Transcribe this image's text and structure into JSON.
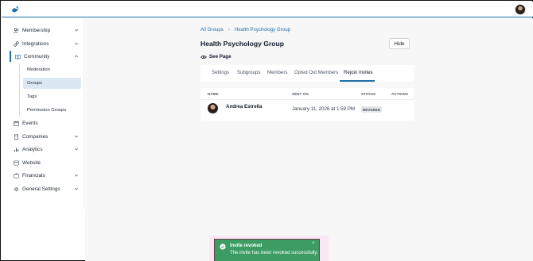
{
  "topbar": {
    "logo_icon": "brand-logo-icon",
    "avatar_icon": "user-avatar"
  },
  "sidebar": {
    "items": [
      {
        "label": "Membership",
        "icon": "people-icon",
        "chevron": "chevron-down-icon"
      },
      {
        "label": "Integrations",
        "icon": "link-icon",
        "chevron": "chevron-down-icon"
      },
      {
        "label": "Community",
        "icon": "book-icon",
        "chevron": "chevron-up-icon",
        "expanded": true,
        "children": [
          "Moderation",
          "Groups",
          "Tags",
          "Permission Groups"
        ],
        "active_child": "Groups"
      },
      {
        "label": "Events",
        "icon": "calendar-icon"
      },
      {
        "label": "Companies",
        "icon": "building-icon",
        "chevron": "chevron-down-icon"
      },
      {
        "label": "Analytics",
        "icon": "bar-chart-icon",
        "chevron": "chevron-down-icon"
      },
      {
        "label": "Website",
        "icon": "globe-icon"
      },
      {
        "label": "Financials",
        "icon": "wallet-icon",
        "chevron": "chevron-down-icon"
      },
      {
        "label": "General Settings",
        "icon": "gear-icon",
        "chevron": "chevron-down-icon"
      }
    ]
  },
  "breadcrumb": {
    "parent": "All Groups",
    "separator": "›",
    "current": "Health Psychology Group"
  },
  "page": {
    "title": "Health Psychology Group",
    "hide_label": "Hide",
    "see_page_label": "See Page"
  },
  "tabs": [
    "Settings",
    "Subgroups",
    "Members",
    "Opted Out Members",
    "Rejoin Invites"
  ],
  "active_tab": "Rejoin Invites",
  "table": {
    "headers": [
      "NAME",
      "SENT ON",
      "STATUS",
      "ACTIONS"
    ],
    "rows": [
      {
        "name": "Andrea Estrella",
        "sent_on": "January 11, 2026 at 1:59 PM",
        "status": "REVOKED"
      }
    ]
  },
  "toast": {
    "title": "Invite revoked",
    "message": "The invite has been revoked successfully.",
    "close": "×"
  },
  "colors": {
    "accent": "#1e6fa8",
    "toast_bg": "#3d9c63",
    "active_nav_bg": "#dbe8f4"
  }
}
